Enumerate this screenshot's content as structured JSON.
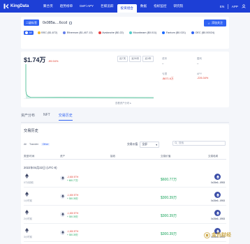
{
  "nav": {
    "logo": "KingData",
    "items": [
      "聚合页",
      "趋势榜单",
      "DeFi APY",
      "巨鲸追踪",
      "投资组合",
      "数据",
      "指标监控",
      "研究院"
    ],
    "active_index": 4,
    "lang": "EN",
    "app": "APP"
  },
  "address": {
    "tag": "二级标签",
    "text": "0x085a....6ccd",
    "follow_button": "添加关注"
  },
  "chains": [
    {
      "label": "All",
      "color": "#2f62f3"
    },
    {
      "label": "BSC ($1,672)",
      "color": "#f3ba2f"
    },
    {
      "label": "Ethereum ($1,407.13)",
      "color": "#627eea"
    },
    {
      "label": "Avalanche ($0.22)",
      "color": "#e84142"
    },
    {
      "label": "Moonbeam ($0.011)",
      "color": "#53cbc8"
    },
    {
      "label": "Fantom ($0.021)",
      "color": "#1969ff"
    },
    {
      "label": "OEC ($0.00024)",
      "color": "#2f62f3"
    }
  ],
  "portfolio": {
    "value": "$1.74万",
    "change": "-99.94%",
    "ranges": [
      "近7天",
      "近30天",
      "近1年"
    ],
    "chart_link": "查看资产分布 ▸"
  },
  "stats": {
    "cost_label": "成本",
    "cost_value": "--",
    "profit_label": "盈利",
    "profit_value": "--",
    "loss_label": "亏损",
    "loss_value": "-$671.6万",
    "apy_label": "APY",
    "apy_value": "-226.34%"
  },
  "tabs": [
    "资产分布",
    "NFT",
    "交易历史"
  ],
  "active_tab": 2,
  "history": {
    "title": "交易历史",
    "filters": [
      "All",
      "Transfer",
      "Other"
    ],
    "active_filter": 2,
    "sort_label": "交易价值",
    "sort_value": "全部",
    "search_placeholder": "搜索",
    "headers": [
      "类型/时间",
      "资产",
      "接收",
      "交易价值",
      "交易哈希"
    ],
    "date": "2022年04月22日 (UTC-8)",
    "rows": [
      {
        "time": "07分钟前",
        "out": "-2,000 ETH",
        "in": "+ 600.77万",
        "value": "$600.77万",
        "hash": "0x28e6...8953"
      },
      {
        "time": "1小时前",
        "out": "-1,000 ETH",
        "in": "+ 300.39万",
        "value": "$300.39万",
        "hash": "0x28e6...8953"
      },
      {
        "time": "2小时前",
        "out": "-1,000 ETH",
        "in": "+ 300.39万",
        "value": "$300.39万",
        "hash": "0x28e6...8953"
      },
      {
        "time": "3小时前",
        "out": "-1,000 ETH",
        "in": "+ 300.39万",
        "value": "$300.39万",
        "hash": "0x28e6...8953"
      }
    ]
  },
  "watermark": "金色财经",
  "colors": {
    "nav": "#1d3fd6",
    "accent": "#2f62f3",
    "negative": "#e0392b",
    "positive": "#17a35a"
  }
}
